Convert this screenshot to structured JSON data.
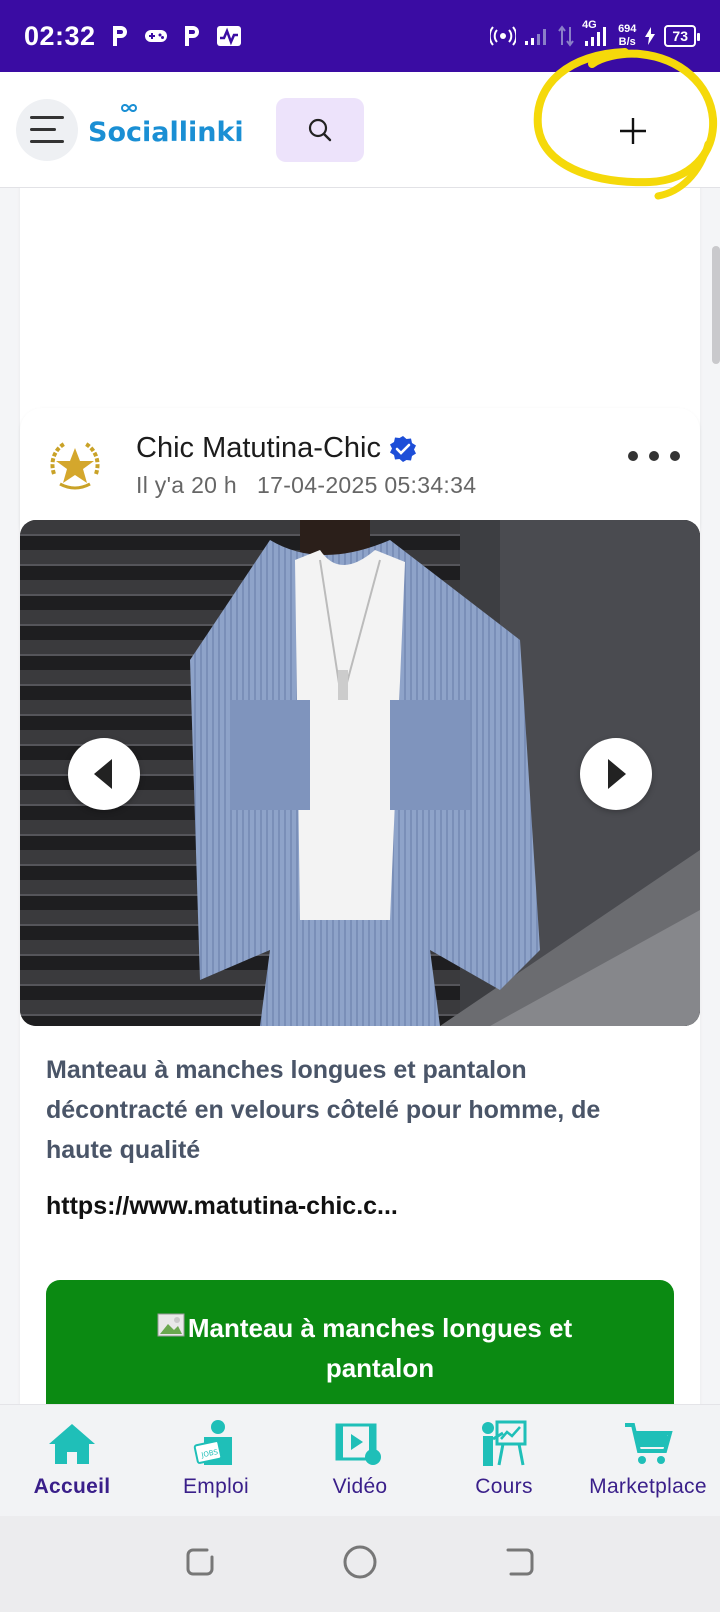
{
  "status_bar": {
    "time": "02:32",
    "network_type": "4G",
    "speed_value": "694",
    "speed_unit": "B/s",
    "battery": "73"
  },
  "header": {
    "logo_text": "Sociallinki",
    "accent_color": "#3a0ca3"
  },
  "post": {
    "author": "Chic Matutina-Chic",
    "relative_time": "Il y'a 20 h",
    "timestamp": "17-04-2025 05:34:34",
    "description": "Manteau à manches longues et pantalon décontracté en velours côtelé pour homme, de haute qualité",
    "link": "https://www.matutina-chic.c...",
    "cta_label": "Manteau à manches longues et pantalon",
    "cta_color": "#0b8a12"
  },
  "bottom_nav": {
    "items": [
      {
        "label": "Accueil",
        "icon": "home-icon"
      },
      {
        "label": "Emploi",
        "icon": "job-icon"
      },
      {
        "label": "Vidéo",
        "icon": "video-icon"
      },
      {
        "label": "Cours",
        "icon": "course-icon"
      },
      {
        "label": "Marketplace",
        "icon": "cart-icon"
      }
    ],
    "icon_color": "#1fbfb8",
    "label_color": "#3a1f8a"
  }
}
